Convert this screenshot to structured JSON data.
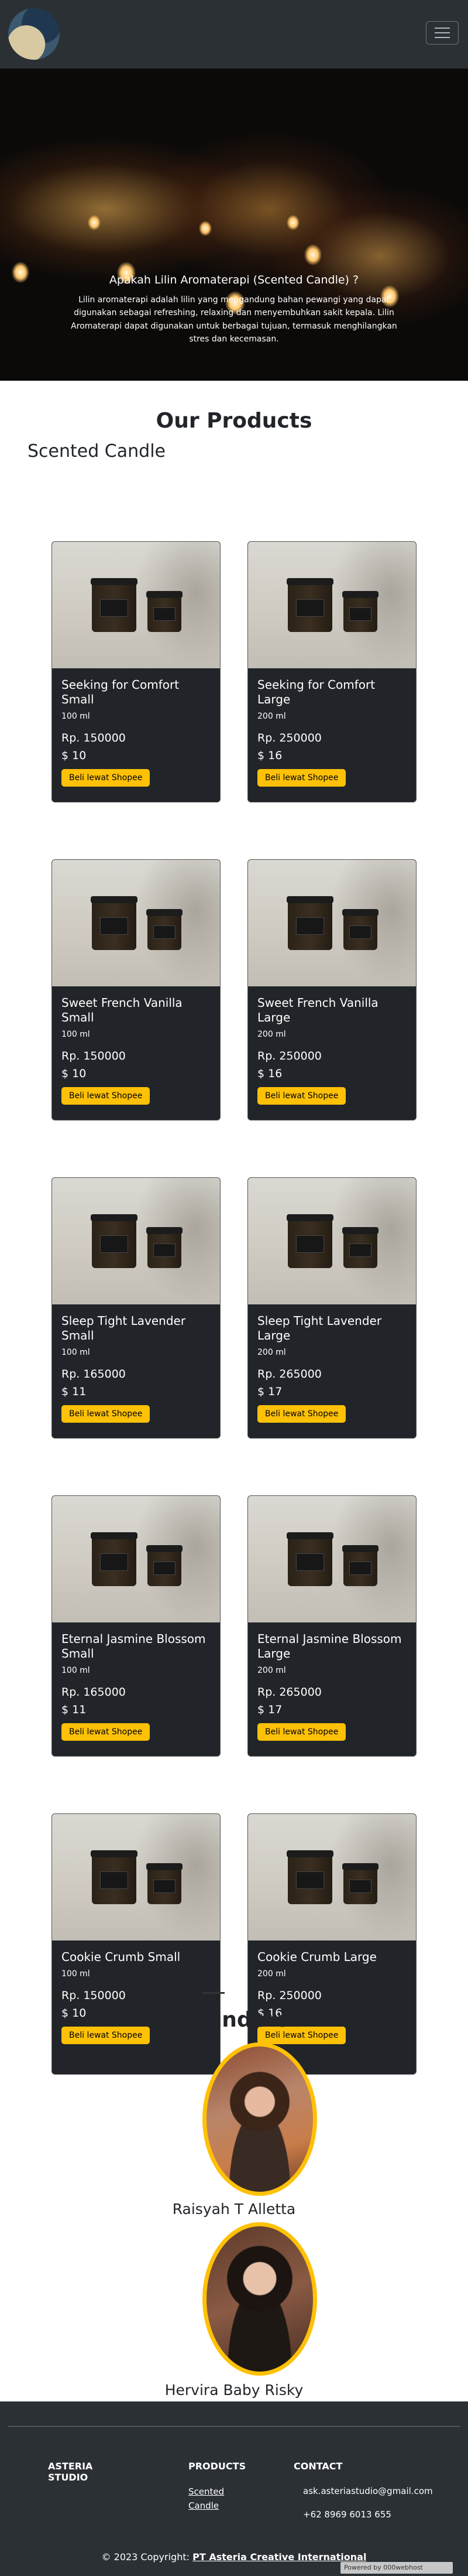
{
  "navbar": {
    "logo_name": "asteria-logo-icon",
    "toggler_icon": "hamburger-menu-icon"
  },
  "hero": {
    "title": "Apakah Lilin Aromaterapi (Scented Candle) ?",
    "text": "Lilin aromaterapi adalah lilin yang mengandung bahan pewangi yang dapat digunakan sebagai refreshing, relaxing dan menyembuhkan sakit kepala. Lilin Aromaterapi dapat digunakan untuk berbagai tujuan, termasuk menghilangkan stres dan kecemasan."
  },
  "products": {
    "title": "Our Products",
    "category": "Scented Candle",
    "items": [
      {
        "name": "Seeking for Comfort Small",
        "size": "100 ml",
        "price_rp": "Rp. 150000",
        "price_usd": "$ 10",
        "button": "Beli lewat Shopee"
      },
      {
        "name": "Seeking for Comfort Large",
        "size": "200 ml",
        "price_rp": "Rp. 250000",
        "price_usd": "$ 16",
        "button": "Beli lewat Shopee"
      },
      {
        "name": "Sweet French Vanilla Small",
        "size": "100 ml",
        "price_rp": "Rp. 150000",
        "price_usd": "$ 10",
        "button": "Beli lewat Shopee"
      },
      {
        "name": "Sweet French Vanilla Large",
        "size": "200 ml",
        "price_rp": "Rp. 250000",
        "price_usd": "$ 16",
        "button": "Beli lewat Shopee"
      },
      {
        "name": "Sleep Tight Lavender Small",
        "size": "100 ml",
        "price_rp": "Rp. 165000",
        "price_usd": "$ 11",
        "button": "Beli lewat Shopee"
      },
      {
        "name": "Sleep Tight Lavender Large",
        "size": "200 ml",
        "price_rp": "Rp. 265000",
        "price_usd": "$ 17",
        "button": "Beli lewat Shopee"
      },
      {
        "name": "Eternal Jasmine Blossom Small",
        "size": "100 ml",
        "price_rp": "Rp. 165000",
        "price_usd": "$ 11",
        "button": "Beli lewat Shopee"
      },
      {
        "name": "Eternal Jasmine Blossom Large",
        "size": "200 ml",
        "price_rp": "Rp. 265000",
        "price_usd": "$ 17",
        "button": "Beli lewat Shopee"
      },
      {
        "name": "Cookie Crumb Small",
        "size": "100 ml",
        "price_rp": "Rp. 150000",
        "price_usd": "$ 10",
        "button": "Beli lewat Shopee"
      },
      {
        "name": "Cookie Crumb Large",
        "size": "200 ml",
        "price_rp": "Rp. 250000",
        "price_usd": "$ 16",
        "button": "Beli lewat Shopee"
      }
    ]
  },
  "founders": {
    "title": "Founders",
    "people": [
      {
        "name": "Raisyah T Alletta"
      },
      {
        "name": "Hervira Baby Risky"
      }
    ]
  },
  "footer": {
    "brand": "ASTERIA STUDIO",
    "products_title": "PRODUCTS",
    "products_link": "Scented Candle",
    "contact_title": "CONTACT",
    "email": "ask.asteriastudio@gmail.com",
    "phone": "+62 8969 6013 655",
    "copyright_prefix": "© 2023 Copyright:",
    "copyright_company": "PT Asteria Creative International",
    "badge": "Powered by 000webhost"
  },
  "colors": {
    "navbar": "#2b3035",
    "card": "#212529",
    "button": "#ffc107",
    "accent_ring": "#ffc107"
  }
}
